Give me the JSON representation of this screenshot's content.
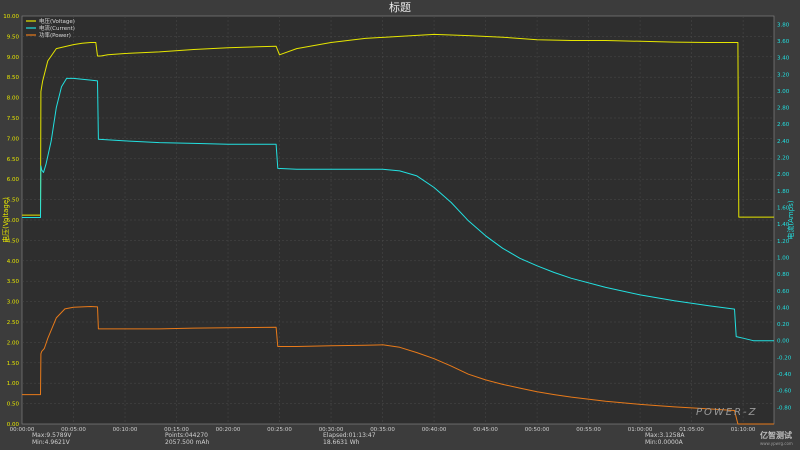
{
  "chart_data": {
    "type": "line",
    "title": "标题",
    "x_unit": "time (hh:mm:ss)",
    "xlim": [
      0,
      4380
    ],
    "x_ticks": [
      "00:00:00",
      "00:05:00",
      "00:10:00",
      "00:15:00",
      "00:20:00",
      "00:25:00",
      "00:30:00",
      "00:35:00",
      "00:40:00",
      "00:45:00",
      "00:50:00",
      "00:55:00",
      "01:00:00",
      "01:05:00",
      "01:10:00"
    ],
    "left_axis": {
      "label": "电压(Voltage)",
      "ylim": [
        0,
        10
      ],
      "ticks": [
        "0.00",
        "0.50",
        "1.00",
        "1.50",
        "2.00",
        "2.50",
        "3.00",
        "3.50",
        "4.00",
        "4.50",
        "5.00",
        "5.50",
        "6.00",
        "6.50",
        "7.00",
        "7.50",
        "8.00",
        "8.50",
        "9.00",
        "9.50",
        "10.00"
      ]
    },
    "right_axis": {
      "label": "电流(Amps)",
      "ylim": [
        -1.0,
        3.9
      ],
      "ticks": [
        "-0.80",
        "-0.60",
        "-0.40",
        "-0.20",
        "0.00",
        "0.20",
        "0.40",
        "0.60",
        "0.80",
        "1.00",
        "1.20",
        "1.40",
        "1.60",
        "1.80",
        "2.00",
        "2.20",
        "2.40",
        "2.60",
        "2.80",
        "3.00",
        "3.20",
        "3.40",
        "3.60",
        "3.80"
      ]
    },
    "legend": {
      "placement": "top-left",
      "entries": [
        {
          "name": "电压(Voltage)",
          "color": "#e6e600"
        },
        {
          "name": "电流(Current)",
          "color": "#22e0e0"
        },
        {
          "name": "功率(Power)",
          "color": "#e87a1a"
        }
      ]
    },
    "series": [
      {
        "name": "电压(Voltage)",
        "axis": "left",
        "color": "#e6e600",
        "x": [
          0,
          108,
          110,
          120,
          150,
          200,
          250,
          300,
          350,
          400,
          430,
          440,
          460,
          500,
          600,
          800,
          1000,
          1200,
          1400,
          1480,
          1500,
          1600,
          1800,
          2000,
          2200,
          2400,
          2600,
          2800,
          3000,
          3200,
          3400,
          3600,
          3800,
          4000,
          4150,
          4170,
          4175,
          4380
        ],
        "y": [
          5.12,
          5.12,
          8.15,
          8.4,
          8.9,
          9.2,
          9.25,
          9.3,
          9.33,
          9.35,
          9.35,
          9.02,
          9.02,
          9.05,
          9.08,
          9.12,
          9.18,
          9.22,
          9.25,
          9.26,
          9.05,
          9.2,
          9.35,
          9.45,
          9.5,
          9.55,
          9.52,
          9.48,
          9.42,
          9.4,
          9.4,
          9.38,
          9.36,
          9.35,
          9.35,
          9.35,
          5.07,
          5.07
        ]
      },
      {
        "name": "电流(Current)",
        "axis": "right",
        "color": "#22e0e0",
        "x": [
          0,
          108,
          110,
          115,
          125,
          140,
          170,
          200,
          230,
          260,
          300,
          400,
          440,
          445,
          600,
          800,
          1000,
          1200,
          1480,
          1490,
          1600,
          1800,
          2000,
          2100,
          2200,
          2300,
          2400,
          2500,
          2600,
          2700,
          2800,
          2900,
          3000,
          3100,
          3200,
          3400,
          3600,
          3800,
          4000,
          4150,
          4160,
          4200,
          4260,
          4380
        ],
        "y": [
          1.48,
          1.48,
          2.1,
          2.05,
          2.02,
          2.12,
          2.4,
          2.8,
          3.05,
          3.15,
          3.15,
          3.13,
          3.12,
          2.42,
          2.4,
          2.38,
          2.37,
          2.36,
          2.36,
          2.07,
          2.06,
          2.06,
          2.06,
          2.06,
          2.04,
          1.98,
          1.84,
          1.66,
          1.44,
          1.26,
          1.11,
          0.99,
          0.9,
          0.82,
          0.75,
          0.64,
          0.55,
          0.48,
          0.42,
          0.38,
          0.05,
          0.03,
          0.0,
          0.0
        ]
      },
      {
        "name": "功率(Power)",
        "axis": "left",
        "color": "#e87a1a",
        "x": [
          0,
          108,
          110,
          115,
          130,
          150,
          200,
          250,
          300,
          400,
          440,
          445,
          600,
          800,
          1000,
          1200,
          1480,
          1490,
          1600,
          1800,
          2000,
          2100,
          2200,
          2300,
          2400,
          2500,
          2600,
          2700,
          2800,
          2900,
          3000,
          3100,
          3200,
          3400,
          3600,
          3800,
          4000,
          4150,
          4170,
          4380
        ],
        "y": [
          0.72,
          0.72,
          1.72,
          1.78,
          1.85,
          2.1,
          2.6,
          2.82,
          2.86,
          2.88,
          2.87,
          2.33,
          2.33,
          2.33,
          2.35,
          2.36,
          2.37,
          1.9,
          1.9,
          1.92,
          1.93,
          1.94,
          1.88,
          1.75,
          1.6,
          1.42,
          1.22,
          1.08,
          0.97,
          0.88,
          0.79,
          0.72,
          0.66,
          0.56,
          0.48,
          0.42,
          0.37,
          0.33,
          0.0,
          0.0
        ]
      }
    ]
  },
  "stats": {
    "max_voltage": "Max:9.5789V",
    "min_voltage": "Min:4.9621V",
    "points": "Points:044270",
    "energy_mah": "2057.500 mAh",
    "elapsed": "Elapsed:01:13:47",
    "energy_wh": "18.6631 Wh",
    "max_current": "Max:3.1258A",
    "min_current": "Min:0.0000A"
  },
  "branding": {
    "watermark": "POWER-Z",
    "logo": "亿智测试",
    "logo_sub": "www.ypwrg.com"
  }
}
